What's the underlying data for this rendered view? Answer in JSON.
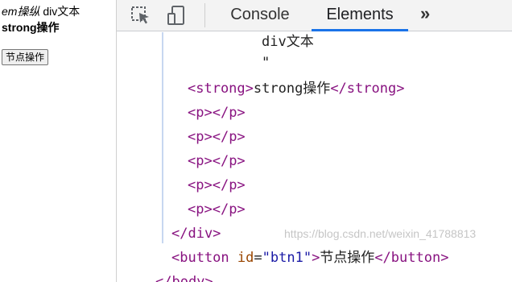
{
  "page": {
    "line1_em": "em操纵",
    "line1_rest": " div文本",
    "line2": "strong操作",
    "button_label": "节点操作"
  },
  "devtools": {
    "tabs": [
      "Console",
      "Elements"
    ],
    "active_tab": "Elements",
    "more_label": "»",
    "icons": [
      "inspect-element-icon",
      "device-toolbar-icon"
    ],
    "accent": "#1a73e8"
  },
  "tree": {
    "text_div": "div文本",
    "text_quote": "\"",
    "strong_open": "<strong>",
    "strong_text": "strong操作",
    "strong_close": "</strong>",
    "p_open": "<p>",
    "p_close": "</p>",
    "div_close": "</div>",
    "button_open_start": "<button",
    "attr_name": "id",
    "attr_eq": "=",
    "attr_value": "\"btn1\"",
    "button_open_end": ">",
    "button_text": "节点操作",
    "button_close": "</button>",
    "body_close": "</body>"
  },
  "watermark": "https://blog.csdn.net/weixin_41788813"
}
